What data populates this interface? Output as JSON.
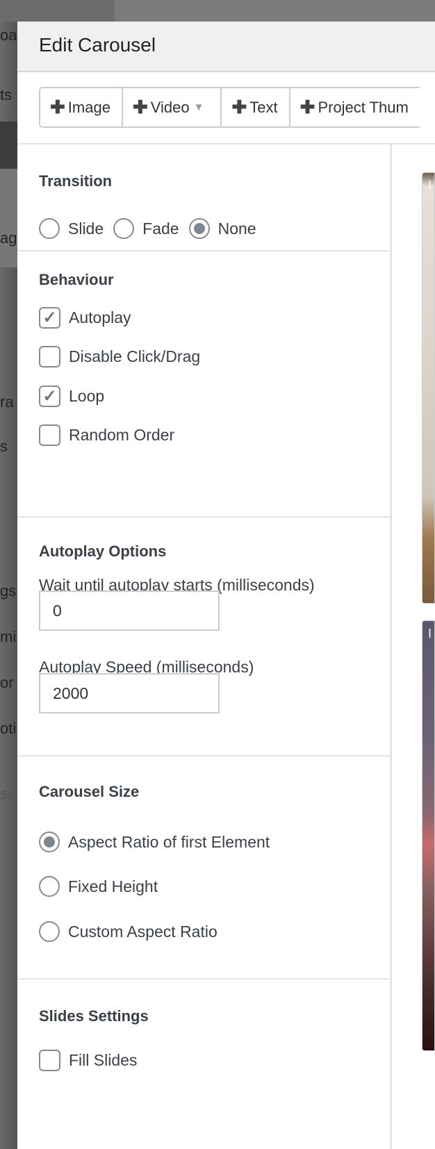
{
  "background_fragments": [
    "oa",
    "ts",
    "ag",
    "ra",
    "s",
    "gs",
    "mi",
    "or",
    "oti",
    "se"
  ],
  "modal": {
    "title": "Edit Carousel",
    "toolbar": [
      {
        "label": "Image",
        "icon": "plus-icon"
      },
      {
        "label": "Video",
        "icon": "plus-icon",
        "dropdown": true
      },
      {
        "label": "Text",
        "icon": "plus-icon"
      },
      {
        "label": "Project Thum",
        "icon": "plus-icon"
      }
    ],
    "transition": {
      "heading": "Transition",
      "options": [
        "Slide",
        "Fade",
        "None"
      ],
      "selected": "None"
    },
    "behaviour": {
      "heading": "Behaviour",
      "options": [
        {
          "label": "Autoplay",
          "checked": true
        },
        {
          "label": "Disable Click/Drag",
          "checked": false
        },
        {
          "label": "Loop",
          "checked": true
        },
        {
          "label": "Random Order",
          "checked": false
        }
      ]
    },
    "autoplay_options": {
      "heading": "Autoplay Options",
      "wait_label": "Wait until autoplay starts (milliseconds)",
      "wait_value": "0",
      "speed_label": "Autoplay Speed (milliseconds)",
      "speed_value": "2000"
    },
    "carousel_size": {
      "heading": "Carousel Size",
      "options": [
        "Aspect Ratio of first Element",
        "Fixed Height",
        "Custom Aspect Ratio"
      ],
      "selected": "Aspect Ratio of first Element"
    },
    "slides_settings": {
      "heading": "Slides Settings",
      "options": [
        {
          "label": "Fill Slides",
          "checked": false
        }
      ]
    },
    "thumbnails": [
      {
        "label": "I"
      },
      {
        "label": "I"
      }
    ]
  }
}
